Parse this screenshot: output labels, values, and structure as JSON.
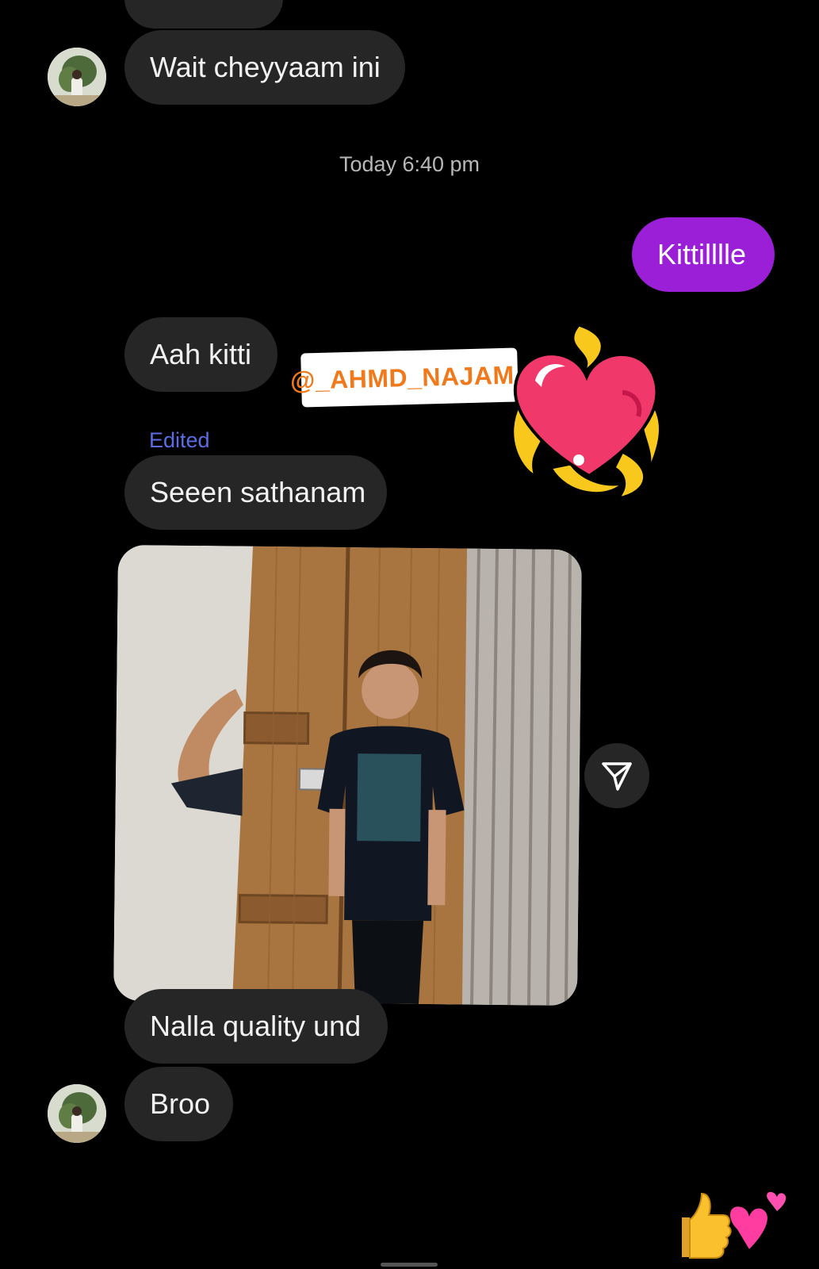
{
  "thread": {
    "messages": [
      {
        "id": "m1",
        "sender": "other",
        "text": "Wait cheyyaam ini"
      },
      {
        "id": "m2",
        "sender": "me",
        "text": "Kittilllle"
      },
      {
        "id": "m3",
        "sender": "other",
        "text": "Aah kitti"
      },
      {
        "id": "m4",
        "sender": "other",
        "text": "Seeen sathanam",
        "edited_label": "Edited"
      },
      {
        "id": "m5",
        "sender": "other",
        "text": "Nalla quality und"
      },
      {
        "id": "m6",
        "sender": "other",
        "text": "Broo"
      }
    ],
    "timestamp": "Today 6:40 pm"
  },
  "stickers": {
    "mention_tag": "@_AHMD_NAJAM_",
    "heart_icon": "flaming-heart-icon"
  },
  "photo_message": {
    "share_icon": "paper-plane-icon"
  },
  "reactions": {
    "icons": [
      "thumbs-up-emoji",
      "two-hearts-emoji"
    ]
  },
  "colors": {
    "background": "#000000",
    "received_bubble": "#262626",
    "sent_bubble": "#9b1fd6",
    "edited_label": "#5b6de4",
    "mention_text": "#f07a1b"
  }
}
